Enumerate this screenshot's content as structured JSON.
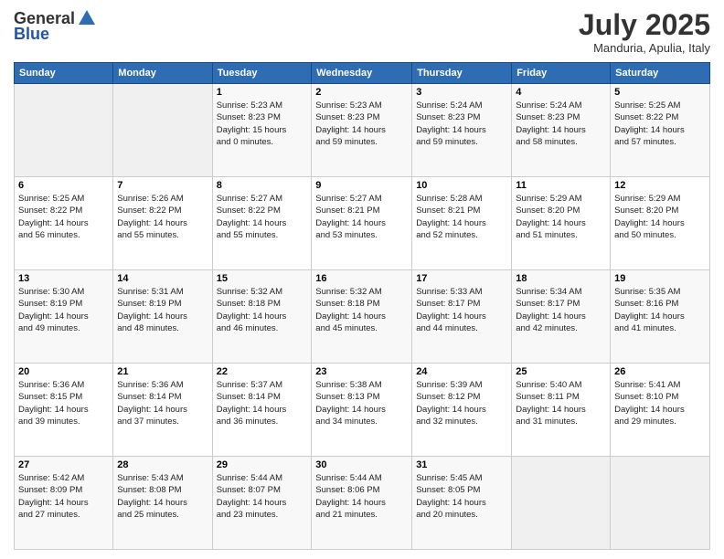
{
  "header": {
    "logo": {
      "text_general": "General",
      "text_blue": "Blue"
    },
    "title": "July 2025",
    "subtitle": "Manduria, Apulia, Italy"
  },
  "days_of_week": [
    "Sunday",
    "Monday",
    "Tuesday",
    "Wednesday",
    "Thursday",
    "Friday",
    "Saturday"
  ],
  "weeks": [
    [
      {
        "day": "",
        "info": ""
      },
      {
        "day": "",
        "info": ""
      },
      {
        "day": "1",
        "info": "Sunrise: 5:23 AM\nSunset: 8:23 PM\nDaylight: 15 hours\nand 0 minutes."
      },
      {
        "day": "2",
        "info": "Sunrise: 5:23 AM\nSunset: 8:23 PM\nDaylight: 14 hours\nand 59 minutes."
      },
      {
        "day": "3",
        "info": "Sunrise: 5:24 AM\nSunset: 8:23 PM\nDaylight: 14 hours\nand 59 minutes."
      },
      {
        "day": "4",
        "info": "Sunrise: 5:24 AM\nSunset: 8:23 PM\nDaylight: 14 hours\nand 58 minutes."
      },
      {
        "day": "5",
        "info": "Sunrise: 5:25 AM\nSunset: 8:22 PM\nDaylight: 14 hours\nand 57 minutes."
      }
    ],
    [
      {
        "day": "6",
        "info": "Sunrise: 5:25 AM\nSunset: 8:22 PM\nDaylight: 14 hours\nand 56 minutes."
      },
      {
        "day": "7",
        "info": "Sunrise: 5:26 AM\nSunset: 8:22 PM\nDaylight: 14 hours\nand 55 minutes."
      },
      {
        "day": "8",
        "info": "Sunrise: 5:27 AM\nSunset: 8:22 PM\nDaylight: 14 hours\nand 55 minutes."
      },
      {
        "day": "9",
        "info": "Sunrise: 5:27 AM\nSunset: 8:21 PM\nDaylight: 14 hours\nand 53 minutes."
      },
      {
        "day": "10",
        "info": "Sunrise: 5:28 AM\nSunset: 8:21 PM\nDaylight: 14 hours\nand 52 minutes."
      },
      {
        "day": "11",
        "info": "Sunrise: 5:29 AM\nSunset: 8:20 PM\nDaylight: 14 hours\nand 51 minutes."
      },
      {
        "day": "12",
        "info": "Sunrise: 5:29 AM\nSunset: 8:20 PM\nDaylight: 14 hours\nand 50 minutes."
      }
    ],
    [
      {
        "day": "13",
        "info": "Sunrise: 5:30 AM\nSunset: 8:19 PM\nDaylight: 14 hours\nand 49 minutes."
      },
      {
        "day": "14",
        "info": "Sunrise: 5:31 AM\nSunset: 8:19 PM\nDaylight: 14 hours\nand 48 minutes."
      },
      {
        "day": "15",
        "info": "Sunrise: 5:32 AM\nSunset: 8:18 PM\nDaylight: 14 hours\nand 46 minutes."
      },
      {
        "day": "16",
        "info": "Sunrise: 5:32 AM\nSunset: 8:18 PM\nDaylight: 14 hours\nand 45 minutes."
      },
      {
        "day": "17",
        "info": "Sunrise: 5:33 AM\nSunset: 8:17 PM\nDaylight: 14 hours\nand 44 minutes."
      },
      {
        "day": "18",
        "info": "Sunrise: 5:34 AM\nSunset: 8:17 PM\nDaylight: 14 hours\nand 42 minutes."
      },
      {
        "day": "19",
        "info": "Sunrise: 5:35 AM\nSunset: 8:16 PM\nDaylight: 14 hours\nand 41 minutes."
      }
    ],
    [
      {
        "day": "20",
        "info": "Sunrise: 5:36 AM\nSunset: 8:15 PM\nDaylight: 14 hours\nand 39 minutes."
      },
      {
        "day": "21",
        "info": "Sunrise: 5:36 AM\nSunset: 8:14 PM\nDaylight: 14 hours\nand 37 minutes."
      },
      {
        "day": "22",
        "info": "Sunrise: 5:37 AM\nSunset: 8:14 PM\nDaylight: 14 hours\nand 36 minutes."
      },
      {
        "day": "23",
        "info": "Sunrise: 5:38 AM\nSunset: 8:13 PM\nDaylight: 14 hours\nand 34 minutes."
      },
      {
        "day": "24",
        "info": "Sunrise: 5:39 AM\nSunset: 8:12 PM\nDaylight: 14 hours\nand 32 minutes."
      },
      {
        "day": "25",
        "info": "Sunrise: 5:40 AM\nSunset: 8:11 PM\nDaylight: 14 hours\nand 31 minutes."
      },
      {
        "day": "26",
        "info": "Sunrise: 5:41 AM\nSunset: 8:10 PM\nDaylight: 14 hours\nand 29 minutes."
      }
    ],
    [
      {
        "day": "27",
        "info": "Sunrise: 5:42 AM\nSunset: 8:09 PM\nDaylight: 14 hours\nand 27 minutes."
      },
      {
        "day": "28",
        "info": "Sunrise: 5:43 AM\nSunset: 8:08 PM\nDaylight: 14 hours\nand 25 minutes."
      },
      {
        "day": "29",
        "info": "Sunrise: 5:44 AM\nSunset: 8:07 PM\nDaylight: 14 hours\nand 23 minutes."
      },
      {
        "day": "30",
        "info": "Sunrise: 5:44 AM\nSunset: 8:06 PM\nDaylight: 14 hours\nand 21 minutes."
      },
      {
        "day": "31",
        "info": "Sunrise: 5:45 AM\nSunset: 8:05 PM\nDaylight: 14 hours\nand 20 minutes."
      },
      {
        "day": "",
        "info": ""
      },
      {
        "day": "",
        "info": ""
      }
    ]
  ]
}
